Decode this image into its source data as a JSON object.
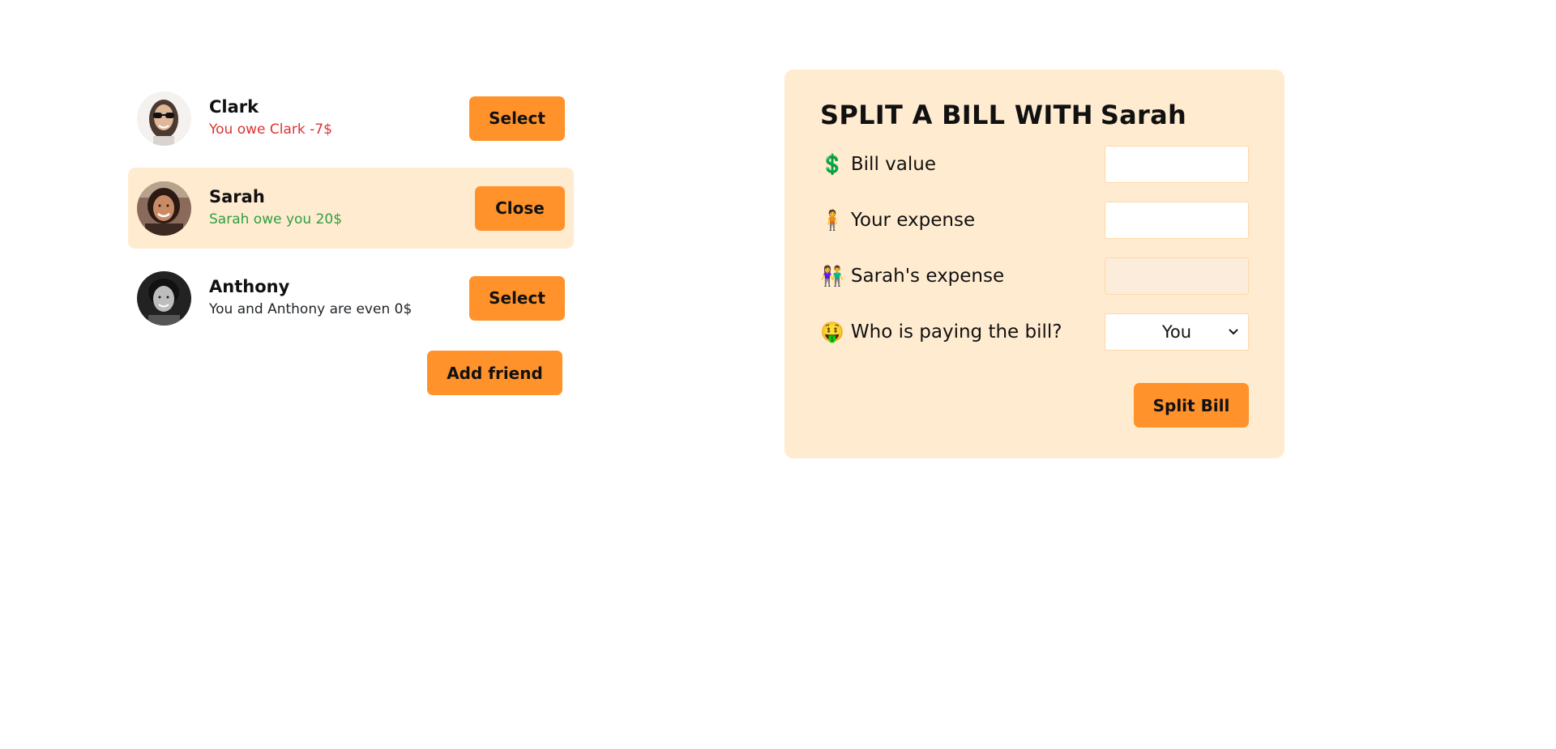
{
  "friends": [
    {
      "name": "Clark",
      "status": "You owe Clark -7$",
      "button_label": "Select",
      "selected": false,
      "status_color": "#e03131"
    },
    {
      "name": "Sarah",
      "status": "Sarah owe you 20$",
      "button_label": "Close",
      "selected": true,
      "status_color": "#2f9e44"
    },
    {
      "name": "Anthony",
      "status": "You and Anthony are even 0$",
      "button_label": "Select",
      "selected": false,
      "status_color": "#212529"
    }
  ],
  "add_friend_label": "Add friend",
  "form": {
    "title_prefix": "SPLIT A BILL WITH",
    "friend_name": "Sarah",
    "rows": {
      "bill_value": {
        "emoji": "💲",
        "label": "Bill value",
        "value": ""
      },
      "your_expense": {
        "emoji": "🧍",
        "label": "Your expense",
        "value": ""
      },
      "friend_expense": {
        "emoji": "👫",
        "label": "Sarah's expense",
        "value": ""
      },
      "payer": {
        "emoji": "🤑",
        "label": "Who is paying the bill?",
        "selected": "You"
      }
    },
    "submit_label": "Split Bill"
  },
  "colors": {
    "accent": "#ff922b",
    "panel": "#ffebd0",
    "owe": "#e03131",
    "owed": "#2f9e44"
  }
}
